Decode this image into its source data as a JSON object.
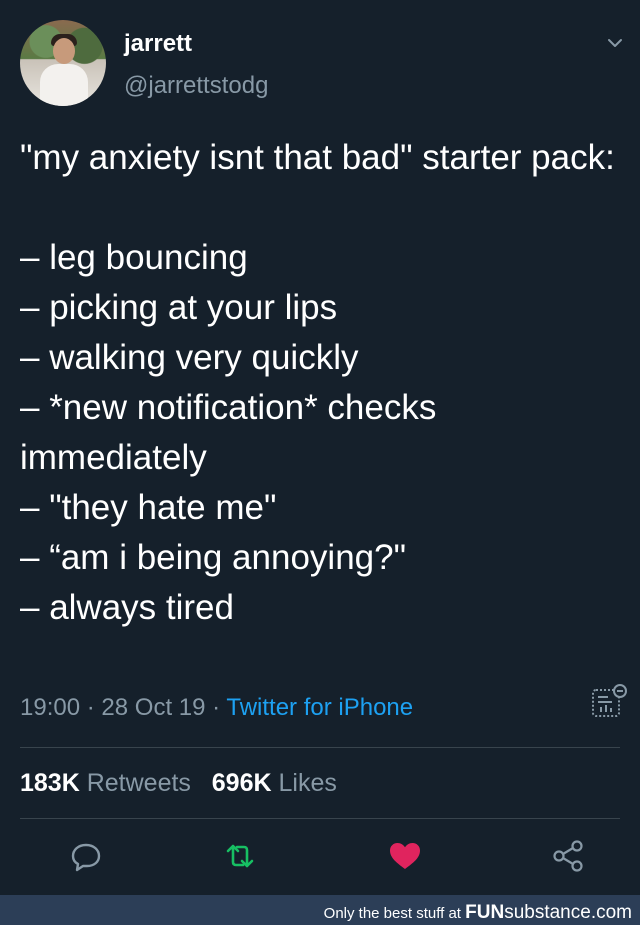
{
  "user": {
    "display_name": "jarrett",
    "handle": "@jarrettstodg"
  },
  "tweet": {
    "text": "\"my anxiety isnt that bad\" starter pack:\n\n– leg bouncing\n– picking at your lips\n– walking very quickly\n– *new notification* checks immediately\n– \"they hate me\"\n– “am i being annoying?\"\n– always tired",
    "time": "19:00",
    "separator": "·",
    "date": "28 Oct 19",
    "source": "Twitter for iPhone"
  },
  "stats": {
    "retweets_count": "183K",
    "retweets_label": "Retweets",
    "likes_count": "696K",
    "likes_label": "Likes"
  },
  "icons": {
    "chevron": "chevron-down-icon",
    "analytics": "analytics-icon",
    "reply": "reply-icon",
    "retweet": "retweet-icon",
    "like": "heart-icon",
    "share": "share-icon"
  },
  "colors": {
    "background": "#15202b",
    "secondary_text": "#8899a6",
    "link": "#1da1f2",
    "retweet_green": "#17bf63",
    "like_red": "#e0245e",
    "footer_bg": "#2c3e57"
  },
  "footer": {
    "tagline": "Only the best stuff at",
    "brand_strong": "FUN",
    "brand_rest": "substance.com"
  }
}
